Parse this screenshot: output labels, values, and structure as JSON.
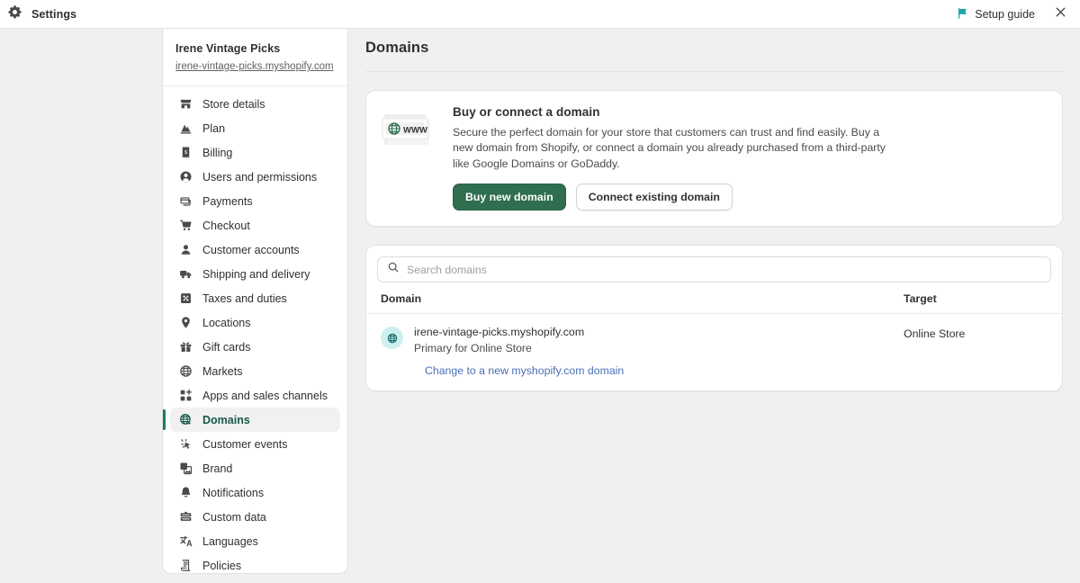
{
  "topbar": {
    "app_title": "Settings",
    "gear_icon": "gear-icon",
    "setup_guide_label": "Setup guide",
    "setup_guide_icon": "flag-icon",
    "close_icon": "close-icon"
  },
  "sidebar": {
    "store_name": "Irene Vintage Picks",
    "store_url": "irene-vintage-picks.myshopify.com",
    "items": [
      {
        "label": "Store details",
        "icon": "storefront-icon",
        "active": false
      },
      {
        "label": "Plan",
        "icon": "plan-icon",
        "active": false
      },
      {
        "label": "Billing",
        "icon": "billing-icon",
        "active": false
      },
      {
        "label": "Users and permissions",
        "icon": "person-icon",
        "active": false
      },
      {
        "label": "Payments",
        "icon": "payments-icon",
        "active": false
      },
      {
        "label": "Checkout",
        "icon": "cart-icon",
        "active": false
      },
      {
        "label": "Customer accounts",
        "icon": "customer-icon",
        "active": false
      },
      {
        "label": "Shipping and delivery",
        "icon": "truck-icon",
        "active": false
      },
      {
        "label": "Taxes and duties",
        "icon": "percent-icon",
        "active": false
      },
      {
        "label": "Locations",
        "icon": "pin-icon",
        "active": false
      },
      {
        "label": "Gift cards",
        "icon": "gift-icon",
        "active": false
      },
      {
        "label": "Markets",
        "icon": "markets-globe-icon",
        "active": false
      },
      {
        "label": "Apps and sales channels",
        "icon": "apps-plus-icon",
        "active": false
      },
      {
        "label": "Domains",
        "icon": "domains-globe-icon",
        "active": true
      },
      {
        "label": "Customer events",
        "icon": "cursor-click-icon",
        "active": false
      },
      {
        "label": "Brand",
        "icon": "brand-image-icon",
        "active": false
      },
      {
        "label": "Notifications",
        "icon": "bell-icon",
        "active": false
      },
      {
        "label": "Custom data",
        "icon": "database-icon",
        "active": false
      },
      {
        "label": "Languages",
        "icon": "translate-icon",
        "active": false
      },
      {
        "label": "Policies",
        "icon": "policies-icon",
        "active": false
      }
    ]
  },
  "main": {
    "page_title": "Domains",
    "banner": {
      "illustration_icon": "www-card-icon",
      "illustration_label": "WWW",
      "title": "Buy or connect a domain",
      "body": "Secure the perfect domain for your store that customers can trust and find easily. Buy a new domain from Shopify, or connect a domain you already purchased from a third-party like Google Domains or GoDaddy.",
      "primary_button": "Buy new domain",
      "secondary_button": "Connect existing domain"
    },
    "domain_list": {
      "search_placeholder": "Search domains",
      "search_value": "",
      "search_icon": "search-icon",
      "columns": {
        "domain": "Domain",
        "target": "Target"
      },
      "rows": [
        {
          "icon": "globe-icon",
          "name": "irene-vintage-picks.myshopify.com",
          "subtitle": "Primary for Online Store",
          "target": "Online Store",
          "link": "Change to a new myshopify.com domain"
        }
      ]
    }
  },
  "colors": {
    "brand_green": "#2f6e4e",
    "active_accent": "#1a7f5a",
    "active_text": "#17584a",
    "link_blue": "#4a6fb5",
    "setup_guide_flag": "#1fa5a0",
    "globe_badge_bg": "#cdf0ef",
    "page_bg": "#f0f0f1"
  }
}
